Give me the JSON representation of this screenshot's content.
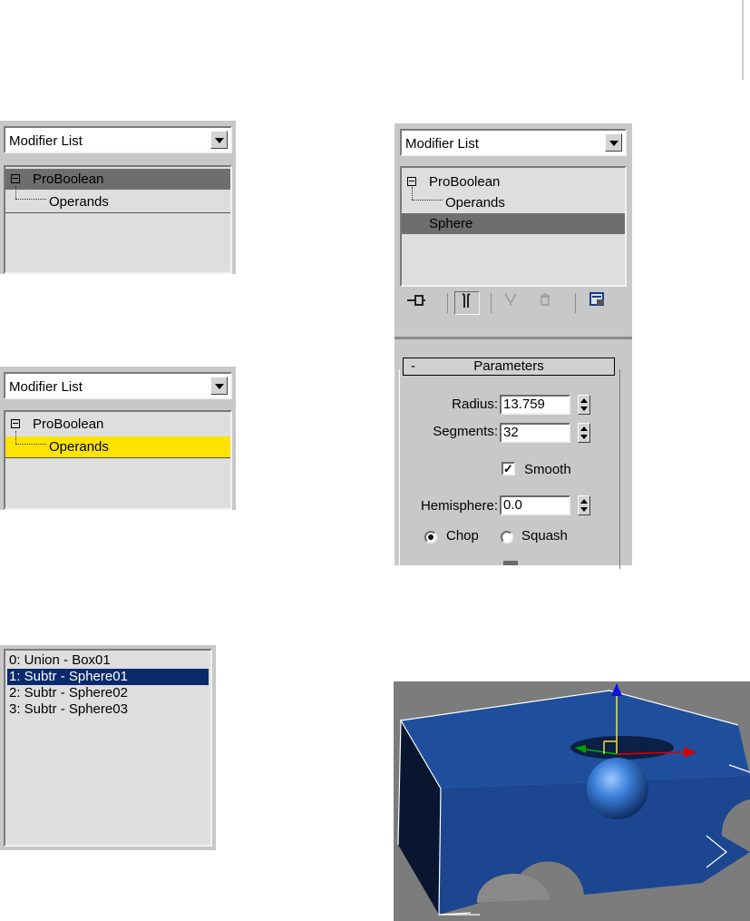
{
  "panel_a": {
    "modifier_list": "Modifier List",
    "items": [
      "ProBoolean",
      "Operands"
    ]
  },
  "panel_b": {
    "modifier_list": "Modifier List",
    "items": [
      "ProBoolean",
      "Operands"
    ]
  },
  "panel_c": {
    "modifier_list": "Modifier List",
    "items": [
      "ProBoolean",
      "Operands",
      "Sphere"
    ],
    "toolbar": {
      "pin_icon": "pin-stack-icon",
      "show_end_icon": "show-end-result-icon",
      "unique_icon": "make-unique-icon",
      "remove_icon": "remove-modifier-icon",
      "configure_icon": "configure-modifier-sets-icon"
    },
    "parameters": {
      "collapse": "-",
      "title": "Parameters",
      "radius_label": "Radius:",
      "radius_value": "13.759",
      "segments_label": "Segments:",
      "segments_value": "32",
      "smooth_label": "Smooth",
      "smooth_checked": true,
      "hemisphere_label": "Hemisphere:",
      "hemisphere_value": "0.0",
      "chop_label": "Chop",
      "squash_label": "Squash",
      "selected_mode": "Chop"
    }
  },
  "operand_list": {
    "items": [
      "0: Union - Box01",
      "1: Subtr - Sphere01",
      "2: Subtr - Sphere02",
      "3: Subtr - Sphere03"
    ],
    "selected_index": 1
  },
  "viewport": {
    "background": "#7c7c7c",
    "box_color": "#1f4c94",
    "sphere_color": "#3b7fd8",
    "gizmo_x": "#d40000",
    "gizmo_y": "#00a000",
    "gizmo_z": "#1010e0"
  }
}
